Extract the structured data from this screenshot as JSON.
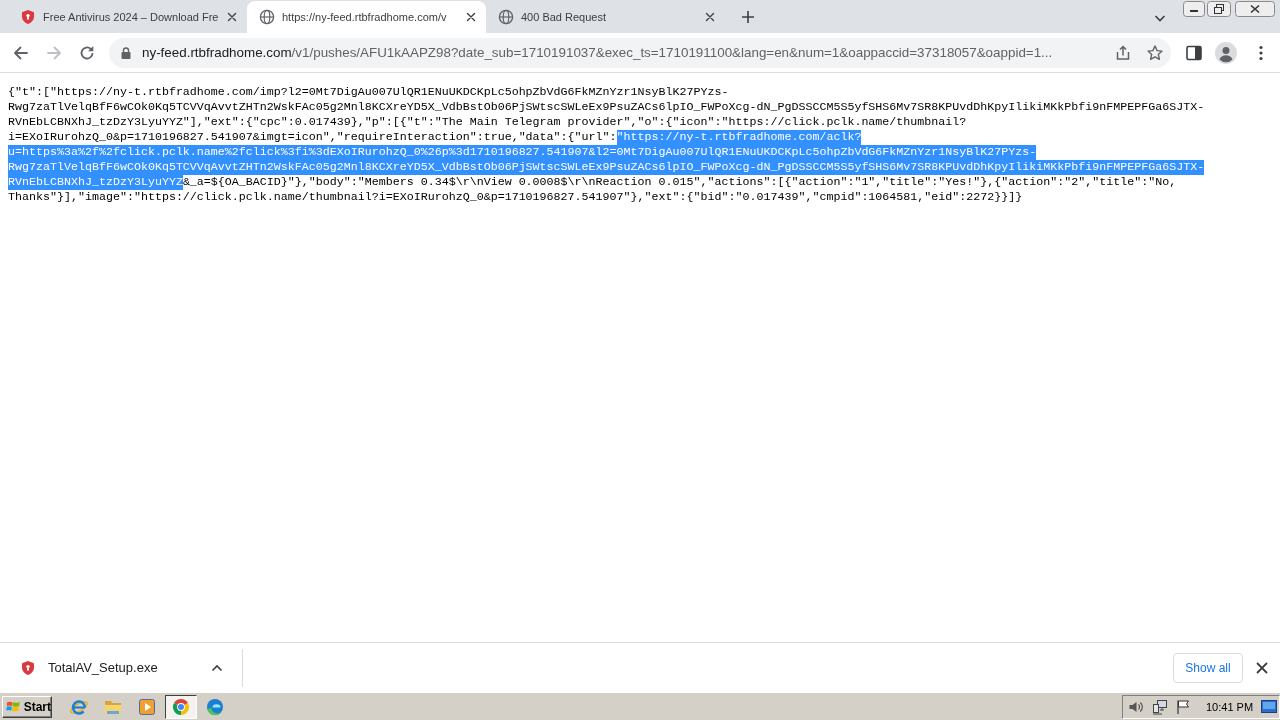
{
  "browser": {
    "tabs": [
      {
        "title": "Free Antivirus 2024 – Download Fre",
        "selected": false
      },
      {
        "title": "https://ny-feed.rtbfradhome.com/v",
        "selected": true
      },
      {
        "title": "400 Bad Request",
        "selected": false
      }
    ],
    "forward": {
      "disabled": true
    },
    "address_bar": {
      "host": "ny-feed.rtbfradhome.com",
      "path": "/v1/pushes/AFU1kAAPZ98?date_sub=1710191037&exec_ts=1710191100&lang=en&num=1&oappaccid=37318057&oappid=1..."
    }
  },
  "page": {
    "lines": [
      {
        "segments": [
          {
            "text": "{\"t\":[\"https://ny-t.rtbfradhome.com/imp?l2=0Mt7DigAu007UlQR1ENuUKDCKpLc5ohpZbVdG6FkMZnYzr1NsyBlK27PYzs-",
            "selected": false
          }
        ]
      },
      {
        "segments": [
          {
            "text": "Rwg7zaTlVelqBfF6wCOk0Kq5TCVVqAvvtZHTn2WskFAc05g2Mnl8KCXreYD5X_VdbBstOb06PjSWtscSWLeEx9PsuZACs6lpIO_FWPoXcg-dN_PgDSSCCM5S5yfSHS6Mv7SR8KPUvdDhKpyIlikiMKkPbfi9nFMPEPFGa6SJTX-",
            "selected": false
          }
        ]
      },
      {
        "segments": [
          {
            "text": "RVnEbLCBNXhJ_tzDzY3LyuYYZ\"],\"ext\":{\"cpc\":0.017439},\"p\":[{\"t\":\"The Main Telegram provider\",\"o\":{\"icon\":\"https://click.pclk.name/thumbnail?",
            "selected": false
          }
        ]
      },
      {
        "segments": [
          {
            "text": "i=EXoIRurohzQ_0&p=1710196827.541907&imgt=icon\",\"requireInteraction\":true,\"data\":{\"url\":",
            "selected": false
          },
          {
            "text": "\"https://ny-t.rtbfradhome.com/aclk?",
            "selected": true
          }
        ]
      },
      {
        "segments": [
          {
            "text": "u=https%3a%2f%2fclick.pclk.name%2fclick%3fi%3dEXoIRurohzQ_0%26p%3d1710196827.541907&l2=0Mt7DigAu007UlQR1ENuUKDCKpLc5ohpZbVdG6FkMZnYzr1NsyBlK27PYzs-",
            "selected": true
          }
        ]
      },
      {
        "segments": [
          {
            "text": "Rwg7zaTlVelqBfF6wCOk0Kq5TCVVqAvvtZHTn2WskFAc05g2Mnl8KCXreYD5X_VdbBstOb06PjSWtscSWLeEx9PsuZACs6lpIO_FWPoXcg-dN_PgDSSCCM5S5yfSHS6Mv7SR8KPUvdDhKpyIlikiMKkPbfi9nFMPEPFGa6SJTX-",
            "selected": true
          }
        ]
      },
      {
        "segments": [
          {
            "text": "RVnEbLCBNXhJ_tzDzY3LyuYYZ",
            "selected": true
          },
          {
            "text": "&_a=${OA_BACID}\"},\"body\":\"Members 0.34$\\r\\nView 0.0008$\\r\\nReaction 0.015\",\"actions\":[{\"action\":\"1\",\"title\":\"Yes!\"},{\"action\":\"2\",\"title\":\"No,",
            "selected": false
          }
        ]
      },
      {
        "segments": [
          {
            "text": "Thanks\"}],\"image\":\"https://click.pclk.name/thumbnail?i=EXoIRurohzQ_0&p=1710196827.541907\"},\"ext\":{\"bid\":\"0.017439\",\"cmpid\":1064581,\"eid\":2272}}]}",
            "selected": false
          }
        ]
      }
    ]
  },
  "download_bar": {
    "file_name": "TotalAV_Setup.exe",
    "show_all": "Show all"
  },
  "taskbar": {
    "start": "Start",
    "quick_launch": [
      {
        "selected": false
      },
      {
        "selected": false
      },
      {
        "selected": false
      },
      {
        "selected": true
      },
      {
        "selected": false
      }
    ],
    "clock": "10:41 PM"
  }
}
